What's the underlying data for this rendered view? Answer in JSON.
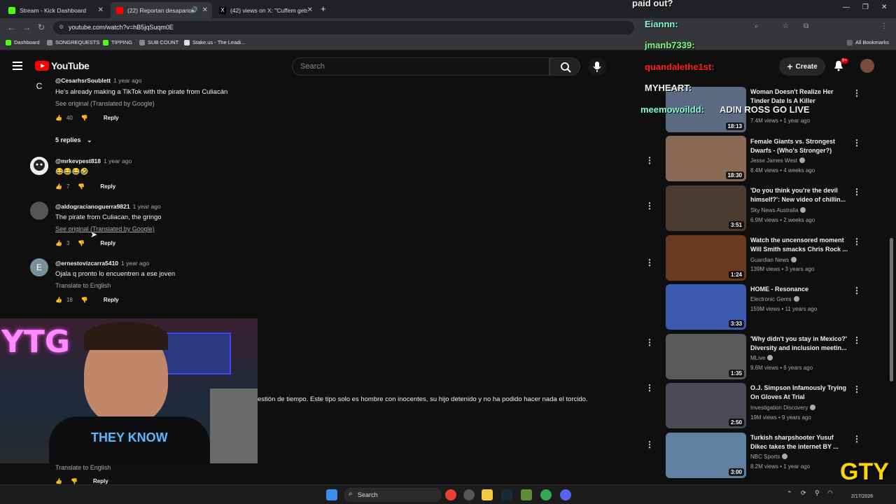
{
  "browser": {
    "tabs": [
      {
        "title": "Stream - Kick Dashboard",
        "color": "#53fc18",
        "active": false
      },
      {
        "title": "(22) Reportan desaparición",
        "color": "#ff0000",
        "active": true
      },
      {
        "title": "(42) views on X: \"Cuffem gets v",
        "color": "#000000",
        "active": false
      }
    ],
    "url": "youtube.com/watch?v=hB5jqSuqm0E",
    "bookmarks": [
      "Dashboard",
      "SONGREQUESTS",
      "TIPPING",
      "SUB COUNT",
      "Stake.us - The Leadi..."
    ],
    "all_bookmarks": "All Bookmarks"
  },
  "youtube": {
    "logo": "YouTube",
    "search_placeholder": "Search",
    "create_label": "Create",
    "notif_count": "9+"
  },
  "comments": [
    {
      "handle": "@CesarhsrSoublett",
      "time": "1 year ago",
      "text": "He's already making a TikTok with the pirate from Culiacán",
      "link": "See original (Translated by Google)",
      "likes": "40",
      "avatar_letter": "C",
      "avatar_color": "#e8710a"
    },
    {
      "handle": "@mrkevpest818",
      "time": "1 year ago",
      "text": "😂😂😂🤣",
      "link": "",
      "likes": "7",
      "avatar_letter": "",
      "avatar_color": "#eeeeee"
    },
    {
      "handle": "@aldogracianoguerra9821",
      "time": "1 year ago",
      "text": "The pirate from Culiacan, the gringo",
      "link": "See original (Translated by Google)",
      "likes": "3",
      "avatar_letter": "",
      "avatar_color": "#555555"
    },
    {
      "handle": "@ernestovizcarra5410",
      "time": "1 year ago",
      "text": "Ojala q pronto lo encuentren a ese joven",
      "link": "Translate to English",
      "likes": "18",
      "avatar_letter": "E",
      "avatar_color": "#78909c"
    }
  ],
  "replies_toggle": "5 replies",
  "reply_label": "Reply",
  "partial_comment": {
    "text": "estión de tiempo. Este tipo solo es hombre con inocentes, su hijo detenido y no ha podido hacer nada el torcido.",
    "link": "Translate to English",
    "reply": "Reply"
  },
  "recommendations": [
    {
      "title": "Woman Doesn't Realize Her Tinder Date Is A Killer",
      "channel": "",
      "meta": "7.4M views • 1 year ago",
      "duration": "18:13",
      "verified": false,
      "thumb": "#5a6a80"
    },
    {
      "title": "Female Giants vs. Strongest Dwarfs - (Who's Stronger?)",
      "channel": "Jesse James West",
      "meta": "8.4M views • 4 weeks ago",
      "duration": "18:30",
      "verified": true,
      "thumb": "#8a6a55"
    },
    {
      "title": "'Do you think you're the devil himself?': New video of chillin...",
      "channel": "Sky News Australia",
      "meta": "6.9M views • 2 weeks ago",
      "duration": "3:51",
      "verified": true,
      "thumb": "#4a3c30"
    },
    {
      "title": "Watch the uncensored moment Will Smith smacks Chris Rock ...",
      "channel": "Guardian News",
      "meta": "139M views • 3 years ago",
      "duration": "1:24",
      "verified": true,
      "thumb": "#6a3a20"
    },
    {
      "title": "HOME - Resonance",
      "channel": "Electronic Gems",
      "meta": "159M views • 11 years ago",
      "duration": "3:33",
      "verified": true,
      "thumb": "#3c5ab0"
    },
    {
      "title": "'Why didn't you stay in Mexico?' Diversity and inclusion meetin...",
      "channel": "MLive",
      "meta": "9.6M views • 6 years ago",
      "duration": "1:35",
      "verified": true,
      "thumb": "#5a5a5a"
    },
    {
      "title": "O.J. Simpson Infamously Trying On Gloves At Trial",
      "channel": "Investigation Discovery",
      "meta": "19M views • 9 years ago",
      "duration": "2:50",
      "verified": true,
      "thumb": "#4a4a55"
    },
    {
      "title": "Turkish sharpshooter Yusuf Dikec takes the internet BY ...",
      "channel": "NBC Sports",
      "meta": "8.2M views • 1 year ago",
      "duration": "3:00",
      "verified": true,
      "thumb": "#6080a0"
    }
  ],
  "stream_chat": [
    {
      "text": "paid out?",
      "color": "#ffffff"
    },
    {
      "text": "Eiannn:",
      "color": "#7fffd4"
    },
    {
      "text": "jmanb7339:",
      "color": "#7fff7f"
    },
    {
      "text": "quandalethe1st:",
      "color": "#ff2020"
    },
    {
      "text": "MYHEART:",
      "color": "#ffffff"
    },
    {
      "text": "meemowoildd:",
      "color": "#7fffd4"
    },
    {
      "text": "ADIN ROSS GO LIVE",
      "color": "#ffffff"
    }
  ],
  "webcam_sign": "YTG",
  "webcam_shirt": "THEY KNOW",
  "taskbar": {
    "search": "Search",
    "time": "",
    "date": "2/17/2026"
  },
  "brand_logo": "GTY"
}
